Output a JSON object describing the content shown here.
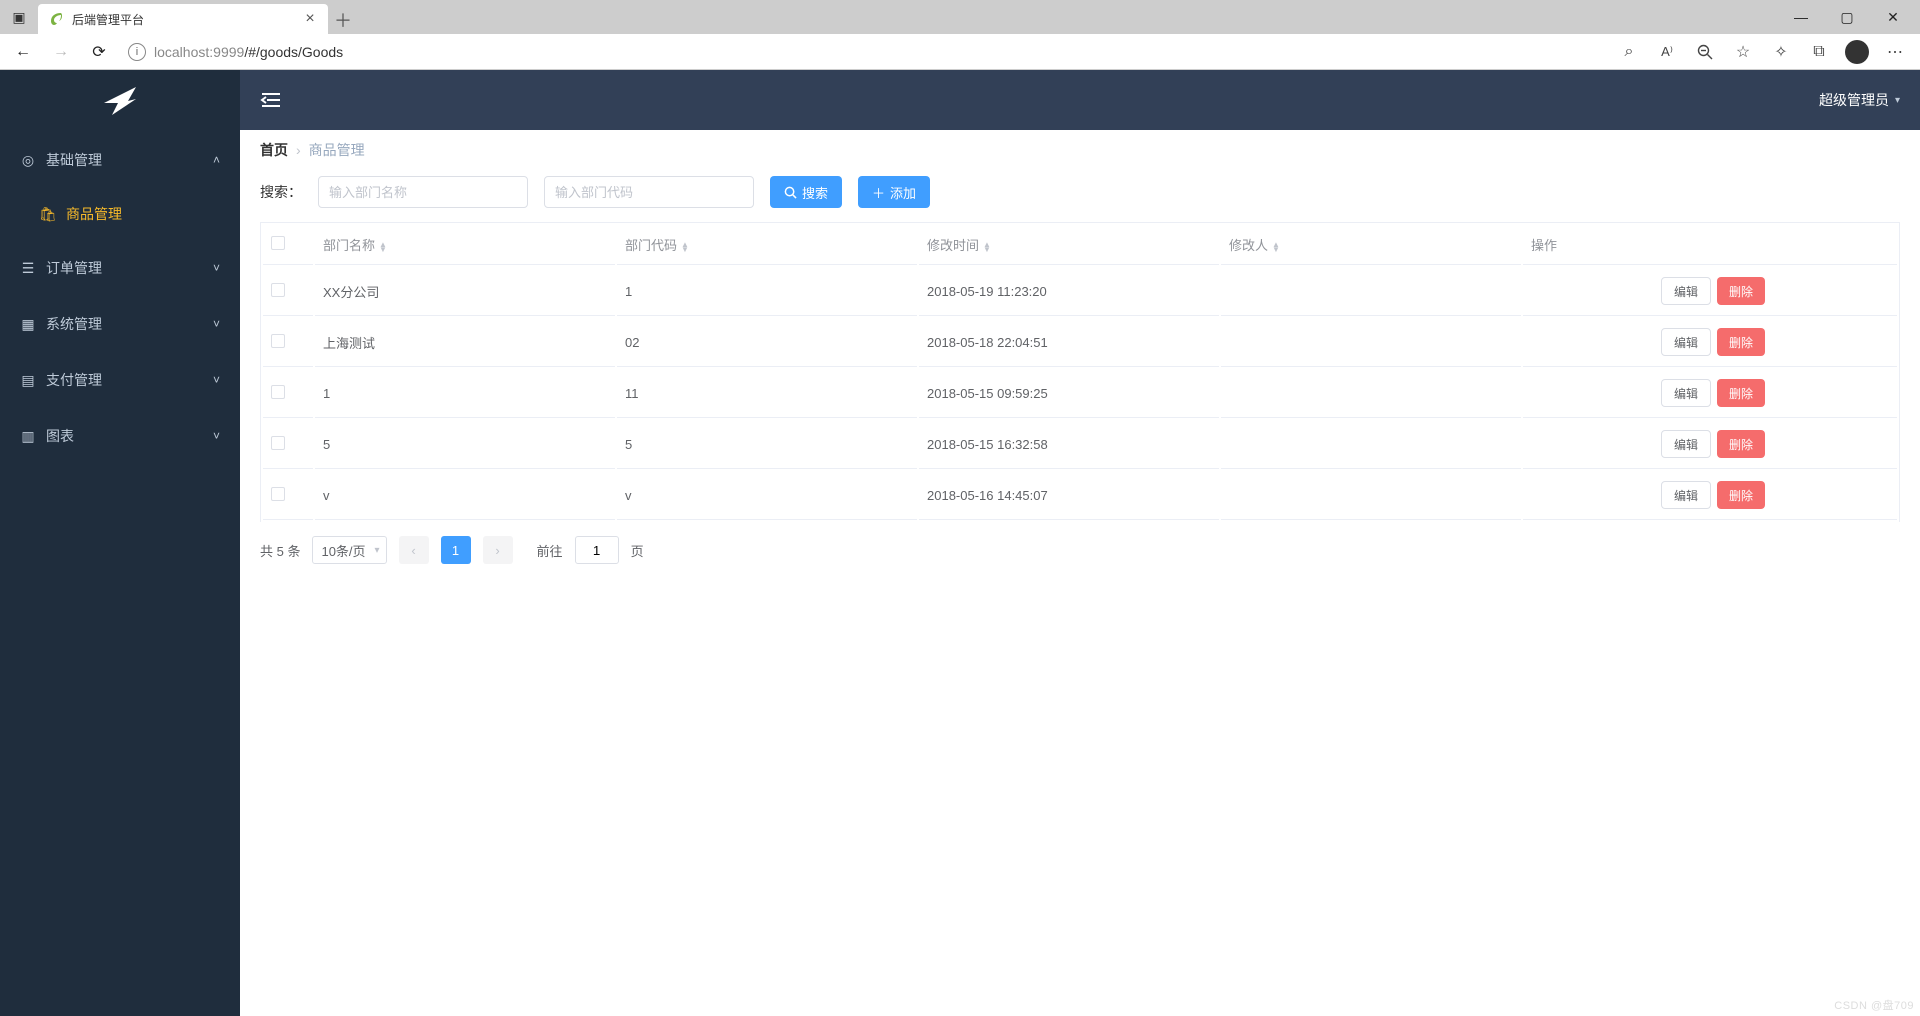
{
  "browser": {
    "tab_title": "后端管理平台",
    "url_host": "localhost",
    "url_port": ":9999",
    "url_path": "/#/goods/Goods"
  },
  "sidebar": {
    "items": [
      {
        "label": "基础管理",
        "expanded": true,
        "children": [
          {
            "label": "商品管理",
            "active": true
          }
        ]
      },
      {
        "label": "订单管理"
      },
      {
        "label": "系统管理"
      },
      {
        "label": "支付管理"
      },
      {
        "label": "图表"
      }
    ]
  },
  "topbar": {
    "user_label": "超级管理员"
  },
  "breadcrumb": {
    "home": "首页",
    "current": "商品管理"
  },
  "search": {
    "label": "搜索：",
    "name_placeholder": "输入部门名称",
    "code_placeholder": "输入部门代码",
    "search_btn": "搜索",
    "add_btn": "添加"
  },
  "table": {
    "headers": {
      "name": "部门名称",
      "code": "部门代码",
      "time": "修改时间",
      "modifier": "修改人",
      "op": "操作"
    },
    "rows": [
      {
        "name": "XX分公司",
        "code": "1",
        "time": "2018-05-19 11:23:20",
        "modifier": ""
      },
      {
        "name": "上海测试",
        "code": "02",
        "time": "2018-05-18 22:04:51",
        "modifier": ""
      },
      {
        "name": "1",
        "code": "11",
        "time": "2018-05-15 09:59:25",
        "modifier": ""
      },
      {
        "name": "5",
        "code": "5",
        "time": "2018-05-15 16:32:58",
        "modifier": ""
      },
      {
        "name": "v",
        "code": "v",
        "time": "2018-05-16 14:45:07",
        "modifier": ""
      }
    ],
    "edit_label": "编辑",
    "delete_label": "删除"
  },
  "pagination": {
    "total_text": "共 5 条",
    "page_size_label": "10条/页",
    "current_page": "1",
    "goto_prefix": "前往",
    "goto_suffix": "页",
    "goto_value": "1"
  },
  "watermark": "CSDN @盘709"
}
